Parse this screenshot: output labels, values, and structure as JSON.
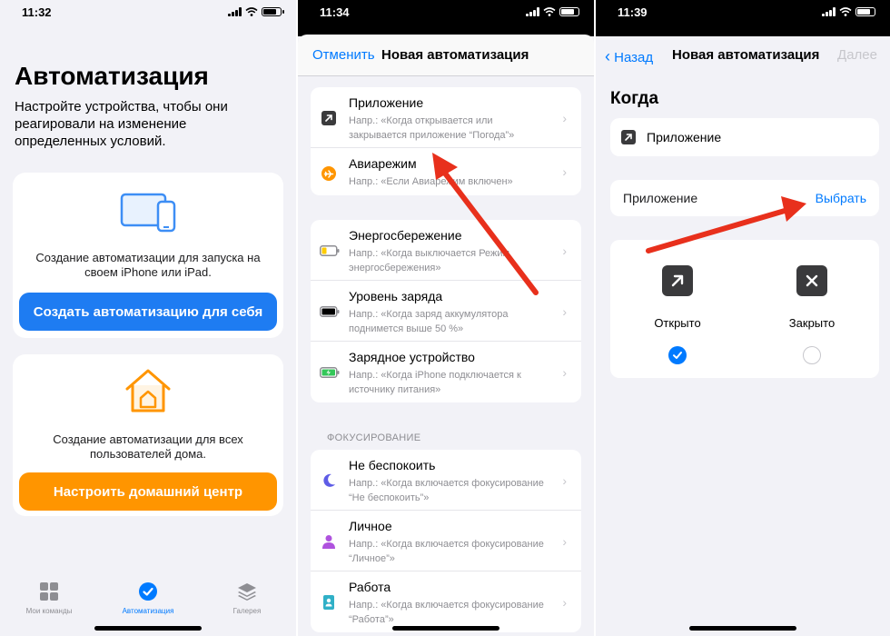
{
  "panel1": {
    "time": "11:32",
    "title": "Автоматизация",
    "subtitle": "Настройте устройства, чтобы они реагировали на изменение определенных условий.",
    "personal": {
      "text": "Создание автоматизации для запуска на своем iPhone или iPad.",
      "button": "Создать автоматизацию для себя",
      "button_color": "#1e7cf2"
    },
    "home": {
      "text": "Создание автоматизации для всех пользователей дома.",
      "button": "Настроить домашний центр",
      "button_color": "#ff9500"
    },
    "tabs": [
      {
        "label": "Мои команды",
        "icon": "grid-icon"
      },
      {
        "label": "Автоматизация",
        "icon": "checkmark-clock-icon",
        "active": true
      },
      {
        "label": "Галерея",
        "icon": "layers-icon"
      }
    ],
    "accent": "#007aff"
  },
  "panel2": {
    "time": "11:34",
    "cancel": "Отменить",
    "title": "Новая автоматизация",
    "group1": [
      {
        "title": "Приложение",
        "subtitle": "Напр.: «Когда открывается или закрывается приложение “Погода”»",
        "icon": "app-arrow-icon"
      },
      {
        "title": "Авиарежим",
        "subtitle": "Напр.: «Если Авиарежим включен»",
        "icon": "airplane-icon"
      }
    ],
    "group2": [
      {
        "title": "Энергосбережение",
        "subtitle": "Напр.: «Когда выключается Режим энергосбережения»",
        "icon": "low-power-battery-icon"
      },
      {
        "title": "Уровень заряда",
        "subtitle": "Напр.: «Когда заряд аккумулятора поднимется выше 50 %»",
        "icon": "battery-icon"
      },
      {
        "title": "Зарядное устройство",
        "subtitle": "Напр.: «Когда iPhone подключается к источнику питания»",
        "icon": "charging-battery-icon"
      }
    ],
    "focus_header": "ФОКУСИРОВАНИЕ",
    "group3": [
      {
        "title": "Не беспокоить",
        "subtitle": "Напр.: «Когда включается фокусирование “Не беспокоить”»",
        "icon": "moon-icon"
      },
      {
        "title": "Личное",
        "subtitle": "Напр.: «Когда включается фокусирование “Личное”»",
        "icon": "person-icon"
      },
      {
        "title": "Работа",
        "subtitle": "Напр.: «Когда включается фокусирование “Работа”»",
        "icon": "badge-icon"
      }
    ]
  },
  "panel3": {
    "time": "11:39",
    "back": "Назад",
    "title": "Новая автоматизация",
    "done": "Далее",
    "when": "Когда",
    "trigger": "Приложение",
    "app_label": "Приложение",
    "choose": "Выбрать",
    "opened": {
      "label": "Открыто",
      "checked": true
    },
    "closed": {
      "label": "Закрыто",
      "checked": false
    }
  }
}
